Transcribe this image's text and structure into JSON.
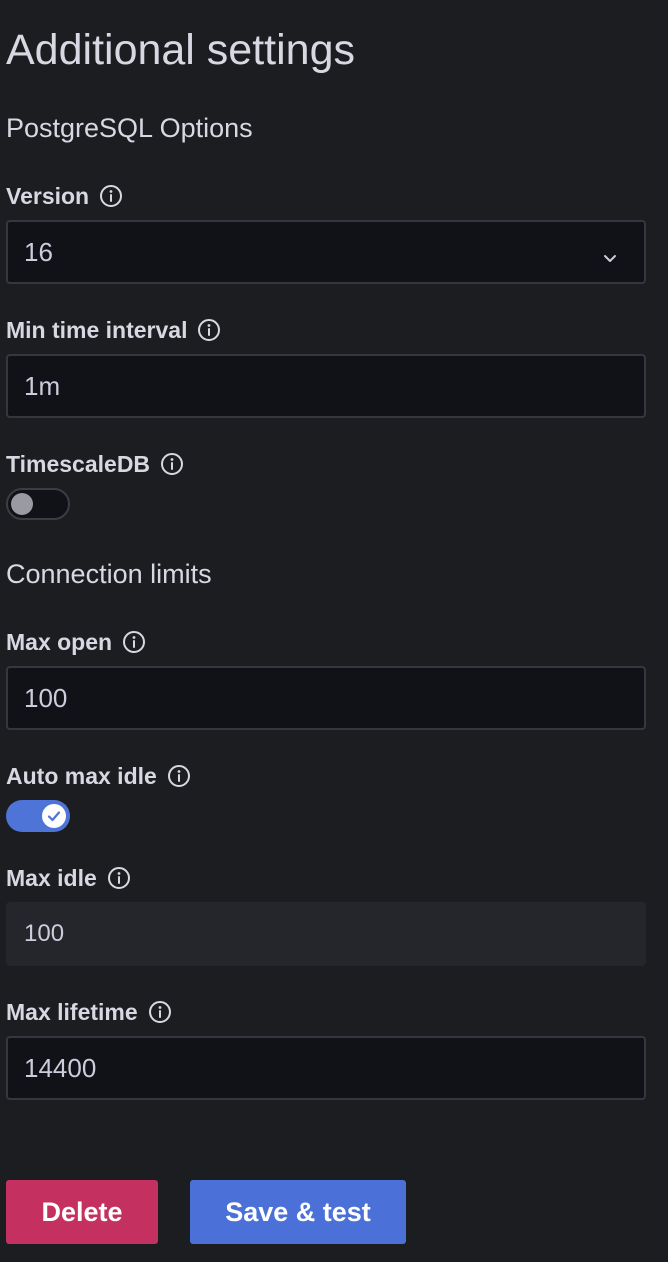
{
  "page": {
    "title": "Additional settings"
  },
  "postgres_options": {
    "section_title": "PostgreSQL Options",
    "version": {
      "label": "Version",
      "value": "16"
    },
    "min_time_interval": {
      "label": "Min time interval",
      "value": "1m"
    },
    "timescaledb": {
      "label": "TimescaleDB",
      "enabled": false
    }
  },
  "connection_limits": {
    "section_title": "Connection limits",
    "max_open": {
      "label": "Max open",
      "value": "100"
    },
    "auto_max_idle": {
      "label": "Auto max idle",
      "enabled": true
    },
    "max_idle": {
      "label": "Max idle",
      "value": "100"
    },
    "max_lifetime": {
      "label": "Max lifetime",
      "value": "14400"
    }
  },
  "actions": {
    "delete_label": "Delete",
    "save_label": "Save & test"
  },
  "colors": {
    "background": "#1c1d21",
    "input_background": "#111217",
    "toggle_on": "#4e74d7",
    "delete_button": "#c4305f",
    "save_button": "#4b71d8"
  },
  "icons": {
    "info": "info-circle-icon",
    "chevron": "chevron-down-icon",
    "check": "check-icon"
  }
}
